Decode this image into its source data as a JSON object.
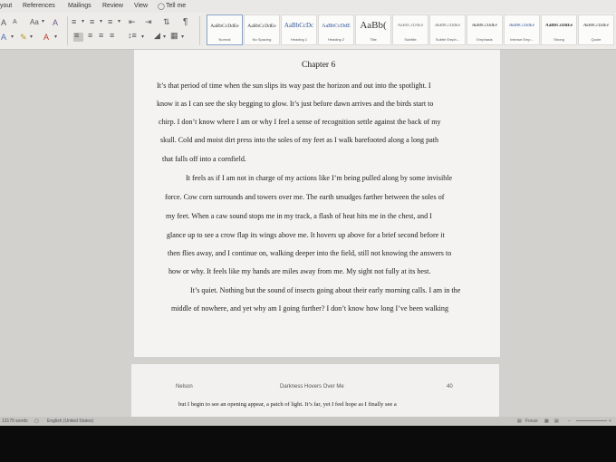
{
  "menu": [
    "yout",
    "References",
    "Mailings",
    "Review",
    "View",
    "Tell me"
  ],
  "ribbon": {
    "font_grow": "A",
    "font_shrink": "A",
    "change_case": "Aa",
    "clear_format": "A",
    "pilcrow": "¶",
    "font_color_label": "A"
  },
  "styles": [
    {
      "preview": "AaBbCcDdEe",
      "name": "Normal"
    },
    {
      "preview": "AaBbCcDdEe",
      "name": "No Spacing"
    },
    {
      "preview": "AaBbCcDc",
      "name": "Heading 1"
    },
    {
      "preview": "AaBbCcDdE",
      "name": "Heading 2"
    },
    {
      "preview": "AaBb(",
      "name": "Title"
    },
    {
      "preview": "AaBbCcDdEe",
      "name": "Subtitle"
    },
    {
      "preview": "AaBbCcDdEe",
      "name": "Subtle Emph..."
    },
    {
      "preview": "AaBbCcDdEe",
      "name": "Emphasis"
    },
    {
      "preview": "AaBbCcDdEe",
      "name": "Intense Emp..."
    },
    {
      "preview": "AaBbCcDdEe",
      "name": "Strong"
    },
    {
      "preview": "AaBbCcDdEe",
      "name": "Quote"
    }
  ],
  "document": {
    "chapter_title": "Chapter 6",
    "lines": [
      "It’s that period of time when the sun slips its way past the horizon and out into the spotlight. I",
      "know it as I can see the sky begging to glow. It’s just before dawn arrives and the birds start to",
      "chirp.  I don’t know where I am or why I feel a sense of recognition settle against the back of my",
      "skull. Cold and moist dirt press into the soles of my feet as I walk barefooted along a long path",
      "that falls off into a cornfield.",
      "It feels as if I am not in charge of my actions like I’m being pulled along by some invisible",
      "force. Cow corn surrounds and towers over me. The earth smudges farther between the soles of",
      "my feet. When a caw sound stops me in my track, a flash of heat hits me in the chest, and I",
      "glance up to see a crow flap its wings above me. It hovers up above for a brief second before it",
      "then flies away, and I continue on, walking deeper into the field, still not knowing the answers to",
      "how or why. It feels like my hands are miles away from me. My sight not fully at its best.",
      "It’s quiet. Nothing but the sound of insects going about their early morning calls. I am in the",
      "middle of nowhere, and yet why am I going further? I don’t know how long I’ve been walking"
    ],
    "page2_header": {
      "author": "Nelson",
      "title": "Darkness Hovers Over Me",
      "page": "40"
    },
    "page2_line": "but I begin to see an opening appear, a patch of light. It’s far, yet I feel hope as I finally see a"
  },
  "status": {
    "words": "13175 words",
    "language": "English (United States)",
    "focus": "Focus"
  }
}
